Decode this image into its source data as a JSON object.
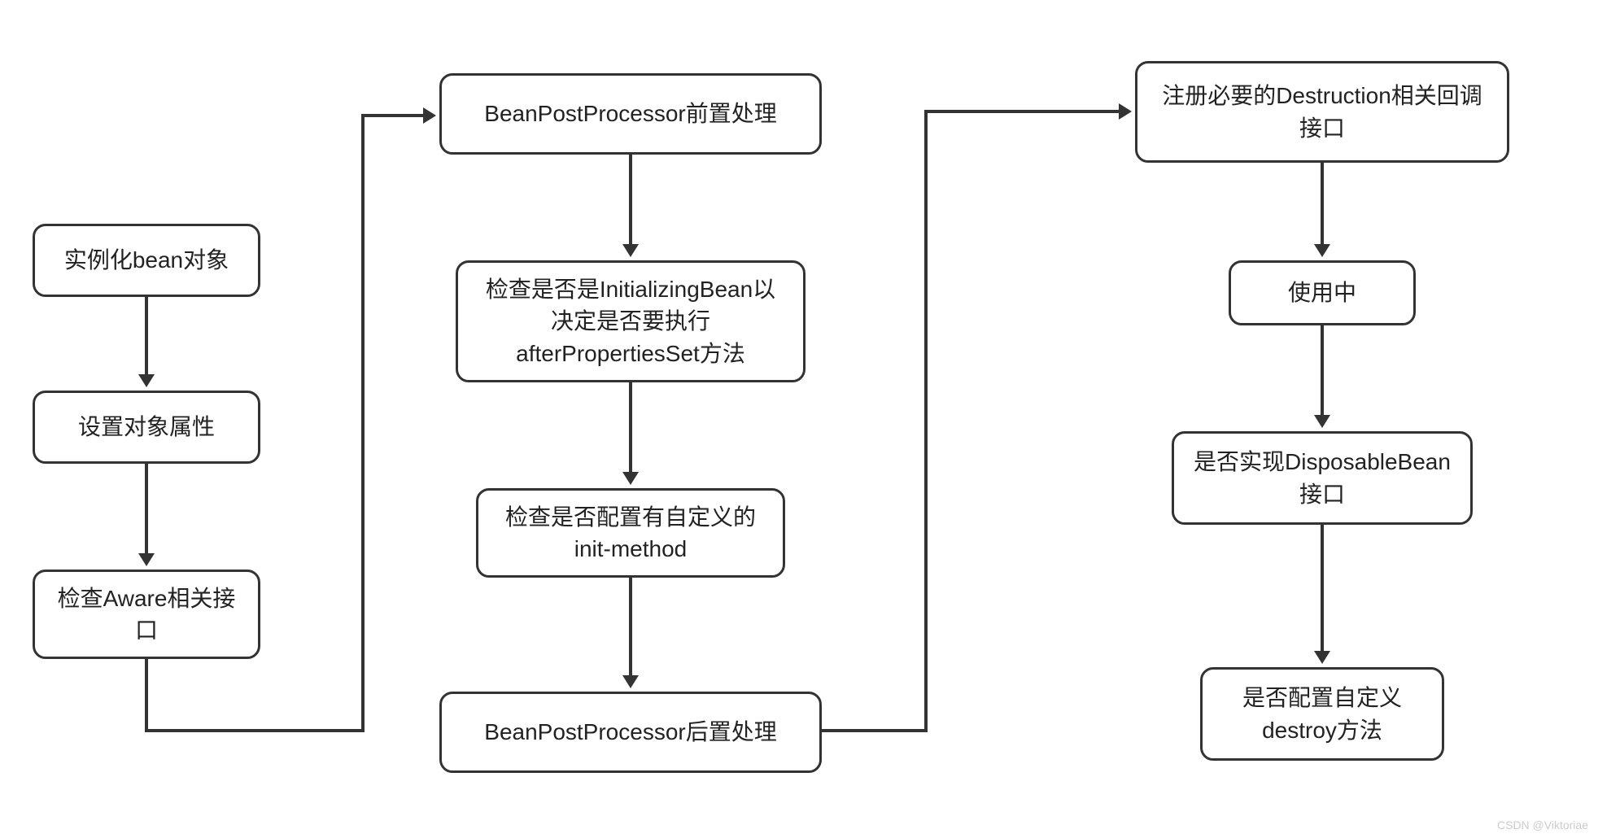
{
  "nodes": {
    "col1_1": "实例化bean对象",
    "col1_2": "设置对象属性",
    "col1_3": "检查Aware相关接口",
    "col2_1": "BeanPostProcessor前置处理",
    "col2_2": "检查是否是InitializingBean以决定是否要执行afterPropertiesSet方法",
    "col2_3": "检查是否配置有自定义的init-method",
    "col2_4": "BeanPostProcessor后置处理",
    "col3_1": "注册必要的Destruction相关回调接口",
    "col3_2": "使用中",
    "col3_3": "是否实现DisposableBean接口",
    "col3_4": "是否配置自定义destroy方法"
  },
  "watermark": "CSDN @Viktoriae"
}
